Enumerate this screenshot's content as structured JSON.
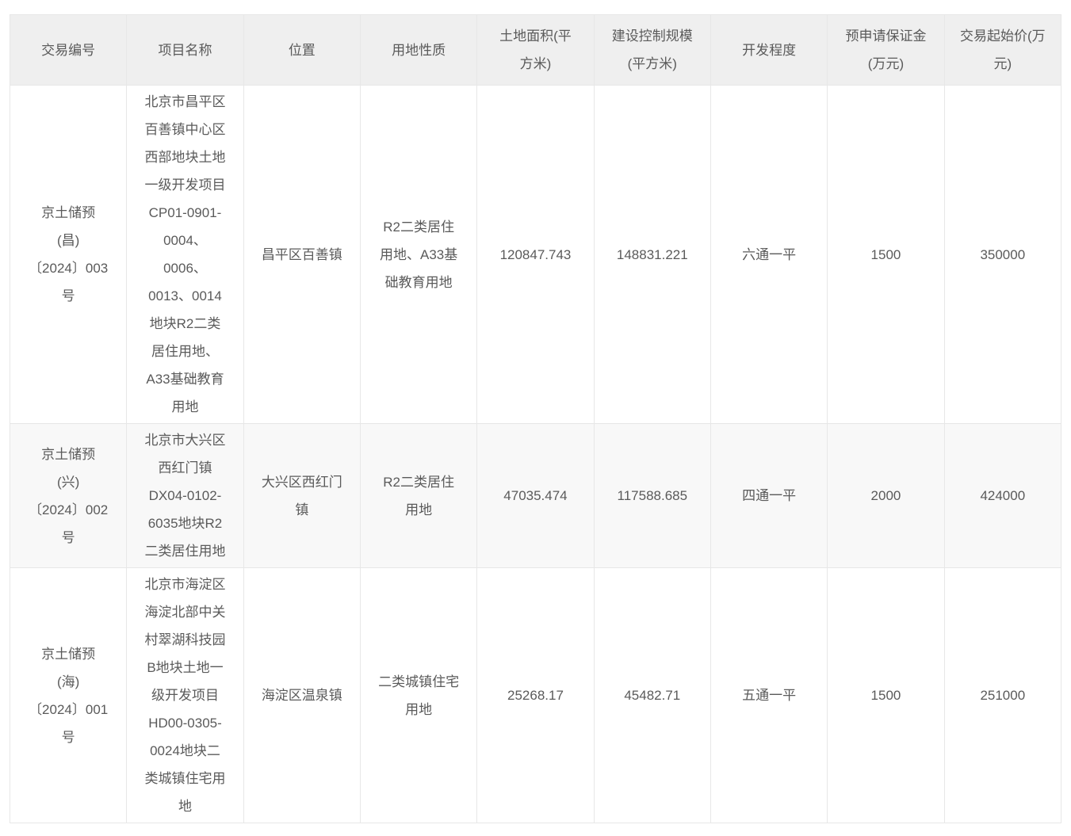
{
  "colors": {
    "link": "#3e7fc1",
    "header_bg": "#efefef",
    "row_alt_bg": "#f8f8f8",
    "border": "#e7e7e7",
    "text": "#5a5a5a"
  },
  "table": {
    "columns": [
      "交易编号",
      "项目名称",
      "位置",
      "用地性质",
      "土地面积(平\n方米)",
      "建设控制规模\n(平方米)",
      "开发程度",
      "预申请保证金\n(万元)",
      "交易起始价(万\n元)"
    ],
    "rows": [
      {
        "transaction_no": "京土储预\n(昌)\n〔2024〕003\n号",
        "project_name": "北京市昌平区\n百善镇中心区\n西部地块土地\n一级开发项目\nCP01-0901-\n0004、\n0006、\n0013、0014\n地块R2二类\n居住用地、\nA33基础教育\n用地",
        "location": "昌平区百善镇",
        "land_use": "R2二类居住\n用地、A33基\n础教育用地",
        "land_area": "120847.743",
        "construction_scale": "148831.221",
        "development_degree": "六通一平",
        "deposit": "1500",
        "starting_price": "350000"
      },
      {
        "transaction_no": "京土储预\n(兴)\n〔2024〕002\n号",
        "project_name": "北京市大兴区\n西红门镇\nDX04-0102-\n6035地块R2\n二类居住用地",
        "location": "大兴区西红门\n镇",
        "land_use": "R2二类居住\n用地",
        "land_area": "47035.474",
        "construction_scale": "117588.685",
        "development_degree": "四通一平",
        "deposit": "2000",
        "starting_price": "424000"
      },
      {
        "transaction_no": "京土储预\n(海)\n〔2024〕001\n号",
        "project_name": "北京市海淀区\n海淀北部中关\n村翠湖科技园\nB地块土地一\n级开发项目\nHD00-0305-\n0024地块二\n类城镇住宅用\n地",
        "location": "海淀区温泉镇",
        "land_use": "二类城镇住宅\n用地",
        "land_area": "25268.17",
        "construction_scale": "45482.71",
        "development_degree": "五通一平",
        "deposit": "1500",
        "starting_price": "251000"
      }
    ]
  }
}
